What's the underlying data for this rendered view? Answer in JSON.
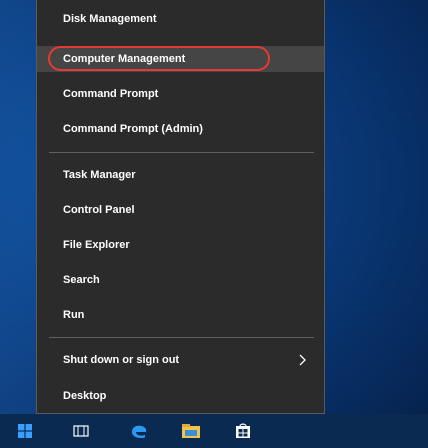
{
  "menu": {
    "items": [
      {
        "label": "Disk Management"
      },
      {
        "label": "Computer Management"
      },
      {
        "label": "Command Prompt"
      },
      {
        "label": "Command Prompt (Admin)"
      },
      {
        "label": "Task Manager"
      },
      {
        "label": "Control Panel"
      },
      {
        "label": "File Explorer"
      },
      {
        "label": "Search"
      },
      {
        "label": "Run"
      },
      {
        "label": "Shut down or sign out"
      },
      {
        "label": "Desktop"
      }
    ],
    "highlighted": "Computer Management",
    "annotation_color": "#e53935"
  },
  "taskbar": {
    "icons": [
      "windows-start-icon",
      "task-view-icon",
      "edge-icon",
      "file-explorer-icon",
      "store-icon"
    ],
    "accent": "#0078d7"
  },
  "colors": {
    "menu_bg": "#2b2b2b",
    "highlight_bg": "#454545",
    "text": "#ffffff"
  }
}
